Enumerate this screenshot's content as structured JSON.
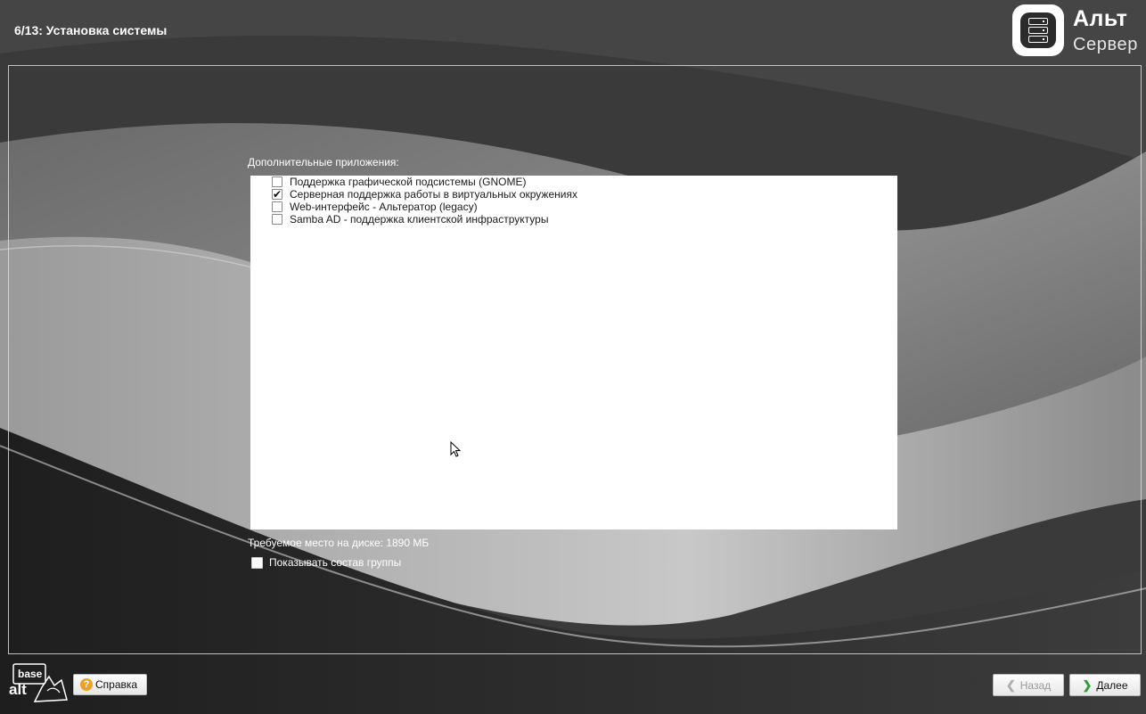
{
  "header": {
    "step_title": "6/13: Установка системы",
    "brand_line1": "Альт",
    "brand_line2": "Сервер"
  },
  "main": {
    "section_label": "Дополнительные приложения:",
    "items": [
      {
        "label": "Поддержка графической подсистемы (GNOME)",
        "checked": false,
        "mark": ""
      },
      {
        "label": "Серверная поддержка работы в виртуальных окружениях",
        "checked": true,
        "mark": "✔"
      },
      {
        "label": "Web-интерфейс - Альтератор (legacy)",
        "checked": false,
        "mark": ""
      },
      {
        "label": "Samba AD - поддержка клиентской инфраструктуры",
        "checked": false,
        "mark": ""
      }
    ],
    "disk_space": "Требуемое место на диске: 1890 МБ",
    "show_group_label": "Показывать состав группы",
    "show_group_checked": false
  },
  "footer": {
    "vendor_logo_line1": "base",
    "vendor_logo_line2": "alt",
    "help_label": "Справка",
    "help_icon_glyph": "?",
    "back_label": "Назад",
    "back_icon_glyph": "❮",
    "next_label": "Далее",
    "next_icon_glyph": "❯"
  },
  "colors": {
    "background": "#333333",
    "next_arrow": "#2f9e30",
    "help_icon": "#f0a020"
  }
}
